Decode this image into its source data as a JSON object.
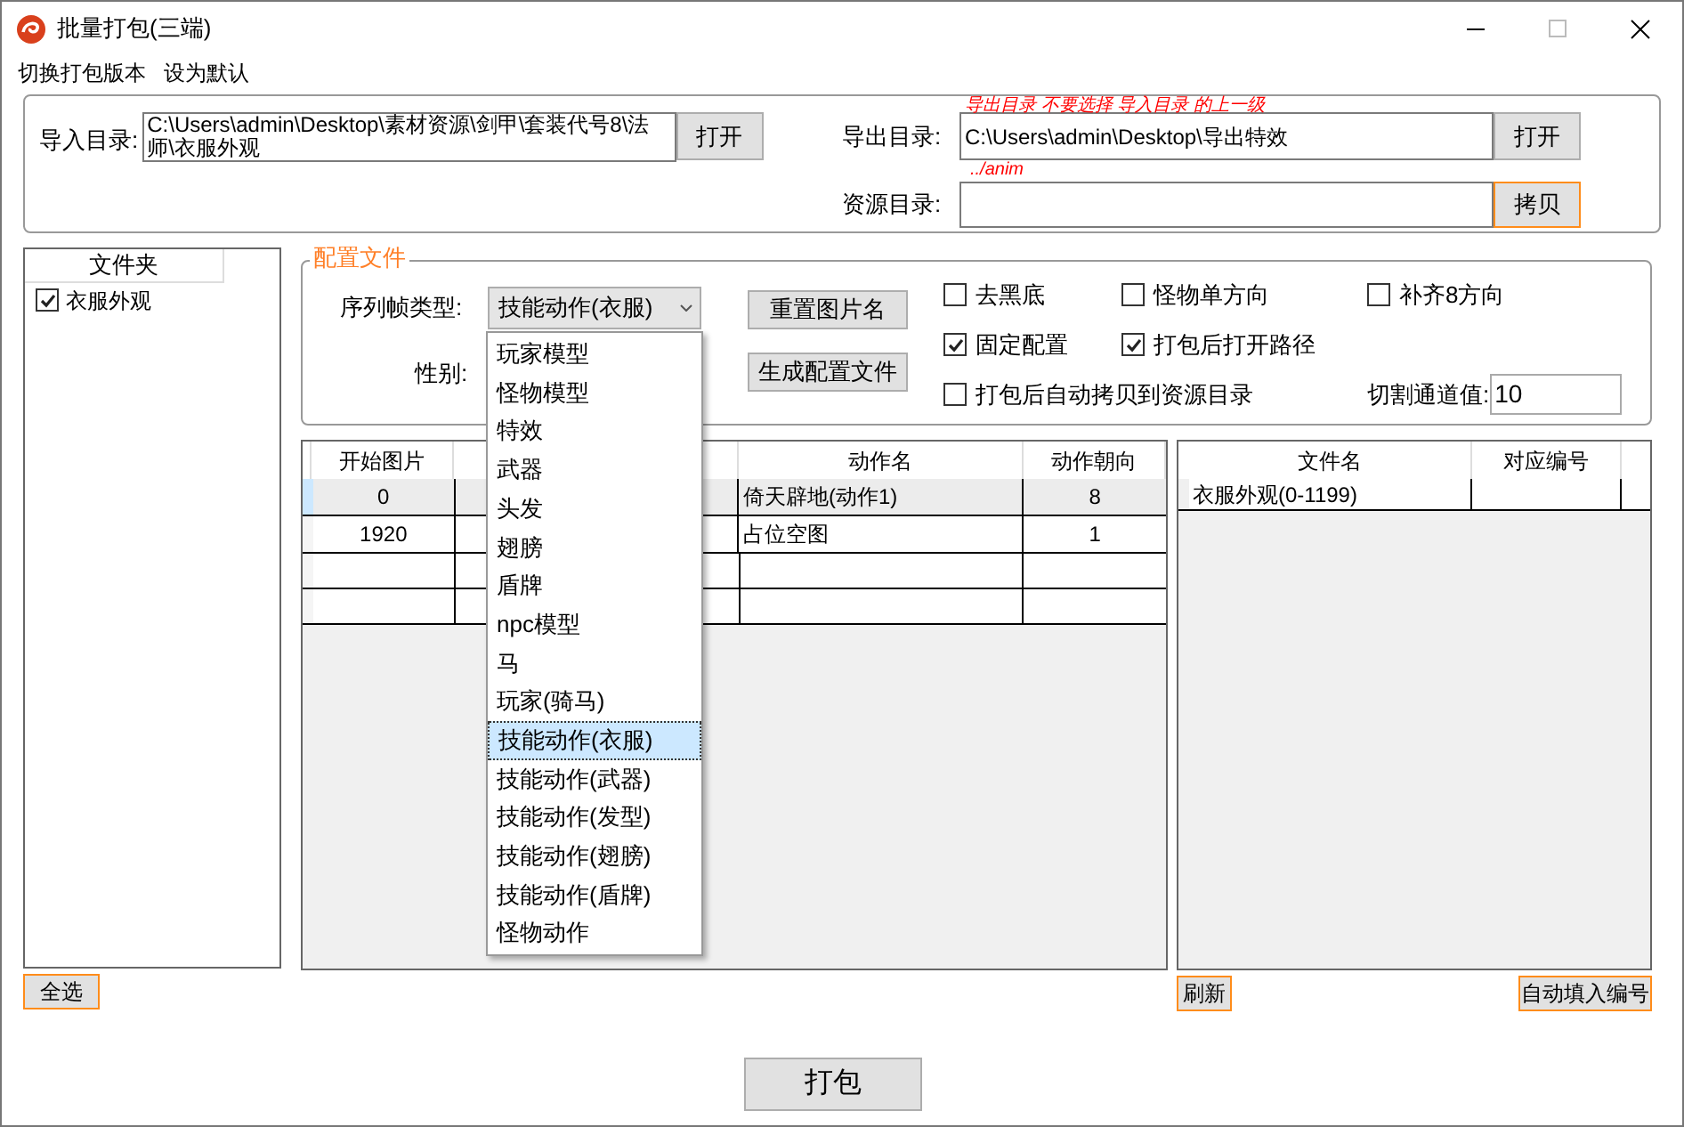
{
  "window": {
    "title": "批量打包(三端)"
  },
  "menu": [
    "切换打包版本",
    "设为默认"
  ],
  "paths": {
    "import": {
      "label": "导入目录:",
      "value": "C:\\Users\\admin\\Desktop\\素材资源\\剑甲\\套装代号8\\法师\\衣服外观",
      "button": {
        "label": "打开",
        "highlighted": false
      }
    },
    "export_hint": "导出目录 不要选择 导入目录 的上一级",
    "export": {
      "label": "导出目录:",
      "value": "C:\\Users\\admin\\Desktop\\导出特效",
      "button": {
        "label": "打开",
        "highlighted": false
      }
    },
    "resource_hint": "../anim",
    "resource": {
      "label": "资源目录:",
      "button": {
        "label": "拷贝",
        "highlighted": true
      }
    }
  },
  "folders": {
    "header": "文件夹",
    "items": [
      {
        "label": "衣服外观",
        "checked": true
      }
    ],
    "button": {
      "label": "全选",
      "highlighted": true
    }
  },
  "config": {
    "legend": "配置文件",
    "frame_type": {
      "label": "序列帧类型:",
      "value": "技能动作(衣服)",
      "expanded": true,
      "options": [
        {
          "label": "玩家模型",
          "selected": false
        },
        {
          "label": "怪物模型",
          "selected": false
        },
        {
          "label": "特效",
          "selected": false
        },
        {
          "label": "武器",
          "selected": false
        },
        {
          "label": "头发",
          "selected": false
        },
        {
          "label": "翅膀",
          "selected": false
        },
        {
          "label": "盾牌",
          "selected": false
        },
        {
          "label": "npc模型",
          "selected": false
        },
        {
          "label": "马",
          "selected": false
        },
        {
          "label": "玩家(骑马)",
          "selected": false
        },
        {
          "label": "技能动作(衣服)",
          "selected": true
        },
        {
          "label": "技能动作(武器)",
          "selected": false
        },
        {
          "label": "技能动作(发型)",
          "selected": false
        },
        {
          "label": "技能动作(翅膀)",
          "selected": false
        },
        {
          "label": "技能动作(盾牌)",
          "selected": false
        },
        {
          "label": "怪物动作",
          "selected": false
        }
      ]
    },
    "gender": {
      "label": "性别:"
    },
    "buttons": [
      {
        "label": "重置图片名"
      },
      {
        "label": "生成配置文件"
      }
    ],
    "options": [
      [
        {
          "label": "去黑底",
          "checked": false
        },
        {
          "label": "怪物单方向",
          "checked": false
        },
        {
          "label": "补齐8方向",
          "checked": false
        }
      ],
      [
        {
          "label": "固定配置",
          "checked": true
        },
        {
          "label": "打包后打开路径",
          "checked": true
        }
      ],
      [
        {
          "label": "打包后自动拷贝到资源目录",
          "checked": false
        }
      ]
    ],
    "threshold": {
      "label": "切割通道值:",
      "value": "10"
    }
  },
  "frames_table": {
    "columns": [
      {
        "label": "开始图片"
      },
      {},
      {},
      {
        "label": "动作名"
      },
      {
        "label": "动作朝向"
      }
    ],
    "rows": [
      {
        "start": "0",
        "action": "倚天辟地(动作1)",
        "direction": "8",
        "selected": true
      },
      {
        "start": "1920",
        "action": "占位空图",
        "direction": "1",
        "selected": false
      }
    ]
  },
  "files_table": {
    "columns": [
      "文件名",
      "对应编号"
    ],
    "rows": [
      {
        "name": "衣服外观(0-1199)"
      }
    ],
    "buttons": [
      {
        "label": "刷新",
        "highlighted": true
      },
      {
        "label": "自动填入编号",
        "highlighted": true
      }
    ]
  },
  "pack_button": {
    "label": "打包"
  }
}
